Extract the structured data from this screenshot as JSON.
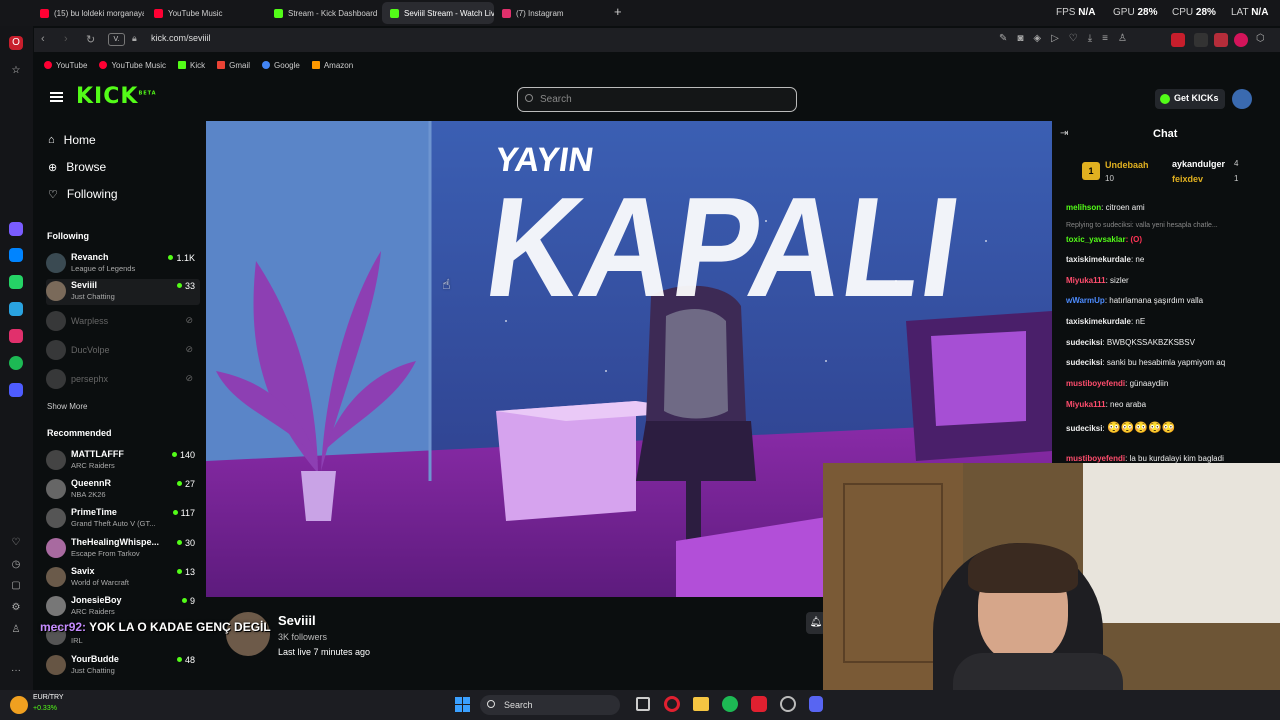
{
  "browser": {
    "tabs": [
      {
        "label": "(15) bu loldeki morganaya",
        "color": "#ff0033",
        "active": false
      },
      {
        "label": "YouTube Music",
        "color": "#ff0033",
        "active": false
      },
      {
        "label": "Stream - Kick Dashboard",
        "color": "#53fc18",
        "active": false
      },
      {
        "label": "Seviiil Stream - Watch Live",
        "color": "#53fc18",
        "active": true
      },
      {
        "label": "(7) Instagram",
        "color": "#e1306c",
        "active": false
      }
    ],
    "stats": {
      "fps_label": "FPS",
      "fps": "N/A",
      "gpu_label": "GPU",
      "gpu": "28%",
      "cpu_label": "CPU",
      "cpu": "28%",
      "lat_label": "LAT",
      "lat": "N/A"
    },
    "url": "kick.com/seviiil",
    "site_badge": "V.",
    "bookmarks": [
      {
        "label": "YouTube",
        "color": "#ff0033"
      },
      {
        "label": "YouTube Music",
        "color": "#ff0033"
      },
      {
        "label": "Kick",
        "color": "#53fc18"
      },
      {
        "label": "Gmail",
        "color": "#ea4335"
      },
      {
        "label": "Google",
        "color": "#4285f4"
      },
      {
        "label": "Amazon",
        "color": "#ff9900"
      }
    ]
  },
  "kick": {
    "search_placeholder": "Search",
    "get_kicks": "Get KICKs",
    "nav": [
      {
        "label": "Home",
        "icon": "home-icon"
      },
      {
        "label": "Browse",
        "icon": "compass-icon"
      },
      {
        "label": "Following",
        "icon": "heart-icon"
      }
    ],
    "following_header": "Following",
    "following": [
      {
        "name": "Revanch",
        "category": "League of Legends",
        "viewers": "1.1K",
        "live": true,
        "color": "#3a4a52"
      },
      {
        "name": "Seviiil",
        "category": "Just Chatting",
        "viewers": "33",
        "live": true,
        "color": "#7a6a5a"
      },
      {
        "name": "Warpless",
        "live": false,
        "color": "#555"
      },
      {
        "name": "DucVolpe",
        "live": false,
        "color": "#555"
      },
      {
        "name": "persephx",
        "live": false,
        "color": "#555"
      }
    ],
    "show_more": "Show More",
    "recommended_header": "Recommended",
    "recommended": [
      {
        "name": "MATTLAFFF",
        "category": "ARC Raiders",
        "viewers": "140",
        "color": "#444"
      },
      {
        "name": "QueennR",
        "category": "NBA 2K26",
        "viewers": "27",
        "color": "#666"
      },
      {
        "name": "PrimeTime",
        "category": "Grand Theft Auto V (GT...",
        "viewers": "117",
        "color": "#555"
      },
      {
        "name": "TheHealingWhispe...",
        "category": "Escape From Tarkov",
        "viewers": "30",
        "color": "#a86aa0"
      },
      {
        "name": "Savix",
        "category": "World of Warcraft",
        "viewers": "13",
        "color": "#6a5a4a"
      },
      {
        "name": "JonesieBoy",
        "category": "ARC Raiders",
        "viewers": "9",
        "color": "#777"
      },
      {
        "name": "",
        "category": "IRL",
        "viewers": "",
        "color": "#555"
      },
      {
        "name": "YourBudde",
        "category": "Just Chatting",
        "viewers": "48",
        "color": "#665544"
      }
    ],
    "offline_title_top": "YAYIN",
    "offline_title_main": "KAPALI",
    "streamer": {
      "name": "Seviiil",
      "followers": "3K followers",
      "last_live": "Last live 7 minutes ago"
    }
  },
  "chat": {
    "title": "Chat",
    "gifters": [
      {
        "rank": "1",
        "name": "Undebaah",
        "count": "10"
      },
      {
        "name": "aykandulger",
        "count": "4"
      },
      {
        "name": "feixdev",
        "count": "1"
      }
    ],
    "messages": [
      {
        "user": "melihson",
        "text": ": citroen ami",
        "color": "#53fc18"
      },
      {
        "user": "",
        "text": "Replying to sudeciksi: valla yeni hesapla chatle...",
        "color": "#888"
      },
      {
        "user": "toxic_yavsaklar",
        "text": ": (O)",
        "color": "#53fc18"
      },
      {
        "user": "taxiskimekurdale",
        "text": ": ne",
        "color": "#ffffff"
      },
      {
        "user": "Miyuka111",
        "text": ": sizler",
        "color": "#ff4d6d"
      },
      {
        "user": "wWarmUp",
        "text": ": hatırlamana şaşırdım valla",
        "color": "#4d8cff"
      },
      {
        "user": "taxiskimekurdale",
        "text": ": nE",
        "color": "#ffffff"
      },
      {
        "user": "sudeciksi",
        "text": ": BWBQKSSAKBZKSBSV",
        "color": "#ffffff"
      },
      {
        "user": "sudeciksi",
        "text": ": sanki bu hesabimla yapmiyom aq",
        "color": "#ffffff"
      },
      {
        "user": "mustiboyefendi",
        "text": ": günaaydiin",
        "color": "#ff4d6d"
      },
      {
        "user": "Miyuka111",
        "text": ": neo araba",
        "color": "#ff4d6d"
      },
      {
        "user": "sudeciksi",
        "text": ":",
        "color": "#ffffff"
      },
      {
        "user": "mustiboyefendi",
        "text": ": la bu kurdalayi kim bagladi",
        "color": "#ff4d6d"
      }
    ]
  },
  "overlay": {
    "user": "mecr92:",
    "text": "YOK LA O KADAE GENÇ DEGİL"
  },
  "taskbar": {
    "search": "Search",
    "ticker": "EUR/TRY",
    "change": "+0.33%"
  }
}
